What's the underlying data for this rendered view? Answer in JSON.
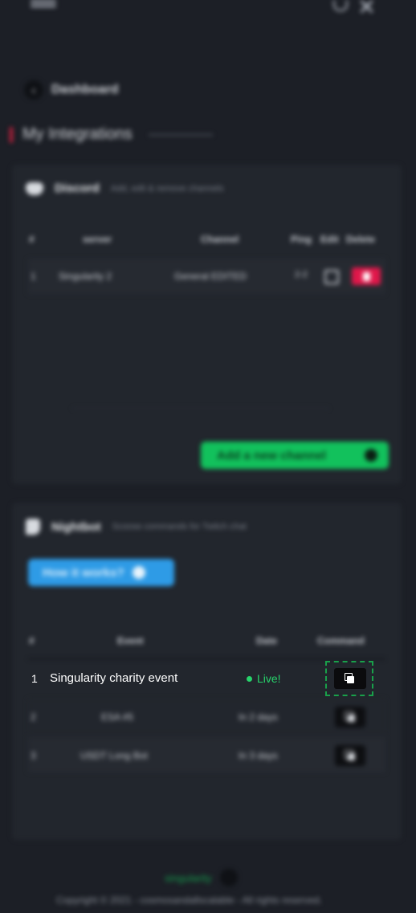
{
  "header": {
    "logo_icon": "logo-icon",
    "notification_icon": "bell-icon",
    "close_icon": "close-icon"
  },
  "nav": {
    "back_label": "Dashboard"
  },
  "page": {
    "title": "My Integrations"
  },
  "discord": {
    "name": "Discord",
    "subtitle": "Add, edit & remove channels",
    "columns": [
      "#",
      "server",
      "Channel",
      "Ping",
      "Edit",
      "Delete"
    ],
    "rows": [
      {
        "num": "1",
        "server": "Singularity 2",
        "channel": "General EDITED",
        "ping": "2-2"
      }
    ],
    "add_button": "Add a new channel"
  },
  "nightbot": {
    "name": "Nightbot",
    "subtitle": "Scoose commands for Twitch chat",
    "how_button": "How it works?",
    "columns": [
      "#",
      "Event",
      "Date",
      "Command"
    ],
    "rows": [
      {
        "num": "1",
        "event": "Singularity charity event",
        "date": "Live!"
      },
      {
        "num": "2",
        "event": "ESA #5",
        "date": "In 2 days"
      },
      {
        "num": "3",
        "event": "USDT Long Bot",
        "date": "In 3 days"
      }
    ]
  },
  "footer": {
    "brand": "singularity",
    "copyright": "Copyright © 2021 - cosmosandallscalable - All rights reserved."
  },
  "colors": {
    "background": "#1c1f26",
    "card": "#22262d",
    "accent_green": "#12c15c",
    "accent_blue": "#2e9be6",
    "delete_red": "#e0174a",
    "live_green": "#27d36b"
  }
}
